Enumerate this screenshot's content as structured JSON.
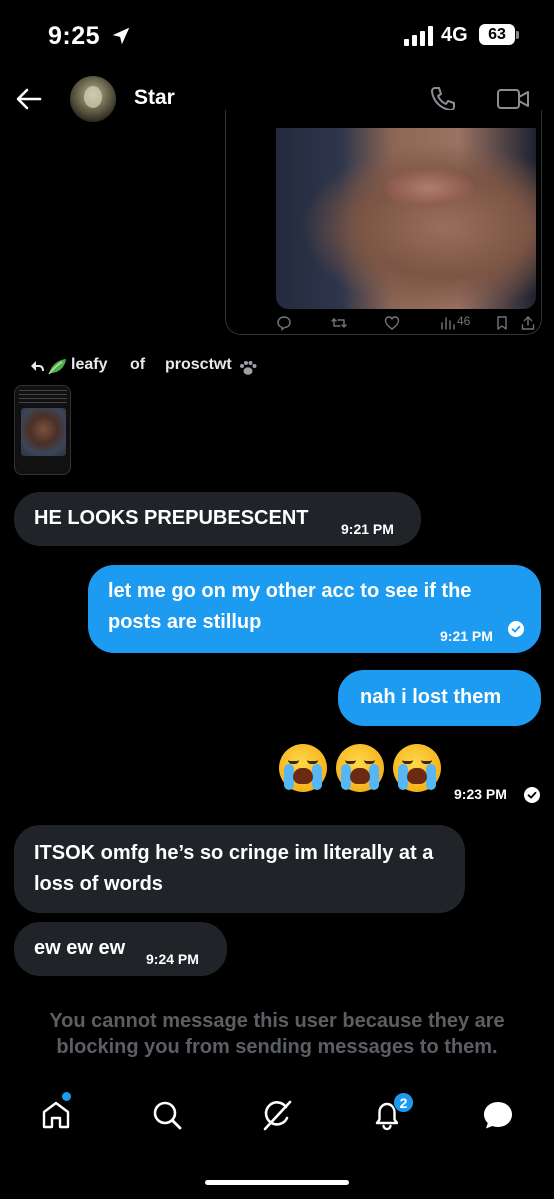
{
  "status_bar": {
    "time": "9:25",
    "network": "4G",
    "battery": "63"
  },
  "header": {
    "contact_name": "Star"
  },
  "tweet_card": {
    "views": "46"
  },
  "reply_context": {
    "word1": "leafy",
    "word2": "of",
    "word3": "prosctwt"
  },
  "messages": [
    {
      "text": "HE LOOKS PREPUBESCENT",
      "time": "9:21 PM",
      "direction": "in"
    },
    {
      "text": "let me go on my other acc to see if the posts are stillup",
      "time": "9:21 PM",
      "direction": "out"
    },
    {
      "text": "nah i lost them",
      "direction": "out"
    },
    {
      "text": "😭 😭 😭",
      "time": "9:23 PM",
      "direction": "out"
    },
    {
      "text": "ITSOK omfg he’s so cringe im literally at a loss of words",
      "direction": "in"
    },
    {
      "text": "ew ew ew",
      "time": "9:24 PM",
      "direction": "in"
    }
  ],
  "blocked_notice": "You cannot message this user because they are blocking you from sending messages to them.",
  "nav": {
    "notifications_badge": "2"
  },
  "colors": {
    "accent": "#1d9bf0",
    "incoming_bubble": "#202327",
    "background": "#000000"
  },
  "icons": [
    "location-arrow-icon",
    "signal-icon",
    "back-arrow-icon",
    "phone-icon",
    "video-camera-icon",
    "reply-icon",
    "retweet-icon",
    "heart-icon",
    "views-icon",
    "bookmark-icon",
    "share-icon",
    "reply-arrow-icon",
    "leaf-icon",
    "paw-icon",
    "read-check-icon",
    "home-icon",
    "search-icon",
    "grok-icon",
    "bell-icon",
    "messages-icon"
  ]
}
